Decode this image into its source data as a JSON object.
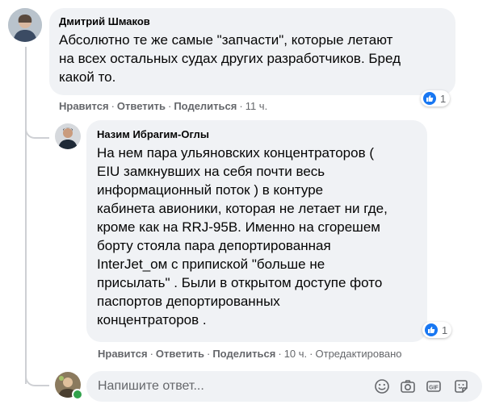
{
  "comments": [
    {
      "author": "Дмитрий Шмаков",
      "lines": [
        "Абсолютно те же самые \"запчасти\", которые летают",
        "на всех остальных судах других разработчиков. Бред",
        "какой то."
      ],
      "actions": {
        "like": "Нравится",
        "reply": "Ответить",
        "share": "Поделиться",
        "time": "11 ч."
      },
      "reactions": "1"
    },
    {
      "author": "Назим Ибрагим-Оглы",
      "lines": [
        "На нем пара ульяновских концентраторов (",
        "EIU замкнувших на себя почти весь",
        "информационный поток ) в контуре",
        "кабинета авионики, которая не летает ни где,",
        "кроме как на RRJ-95B. Именно на сгорешем",
        "борту стояла пара депортированная",
        "InterJet_ом с припиской \"больше не",
        "присылать\" . Были в открытом доступе фото",
        "паспортов депортированных",
        "концентраторов ."
      ],
      "actions": {
        "like": "Нравится",
        "reply": "Ответить",
        "share": "Поделиться",
        "time": "10 ч.",
        "edited": "Отредактировано"
      },
      "reactions": "1"
    }
  ],
  "composer": {
    "placeholder": "Напишите ответ...",
    "icons": [
      "emoji-icon",
      "camera-icon",
      "gif-icon",
      "sticker-icon"
    ]
  },
  "colors": {
    "accent": "#1877f2",
    "bubble": "#f0f2f5",
    "meta": "#65676b",
    "online": "#31a24c"
  }
}
